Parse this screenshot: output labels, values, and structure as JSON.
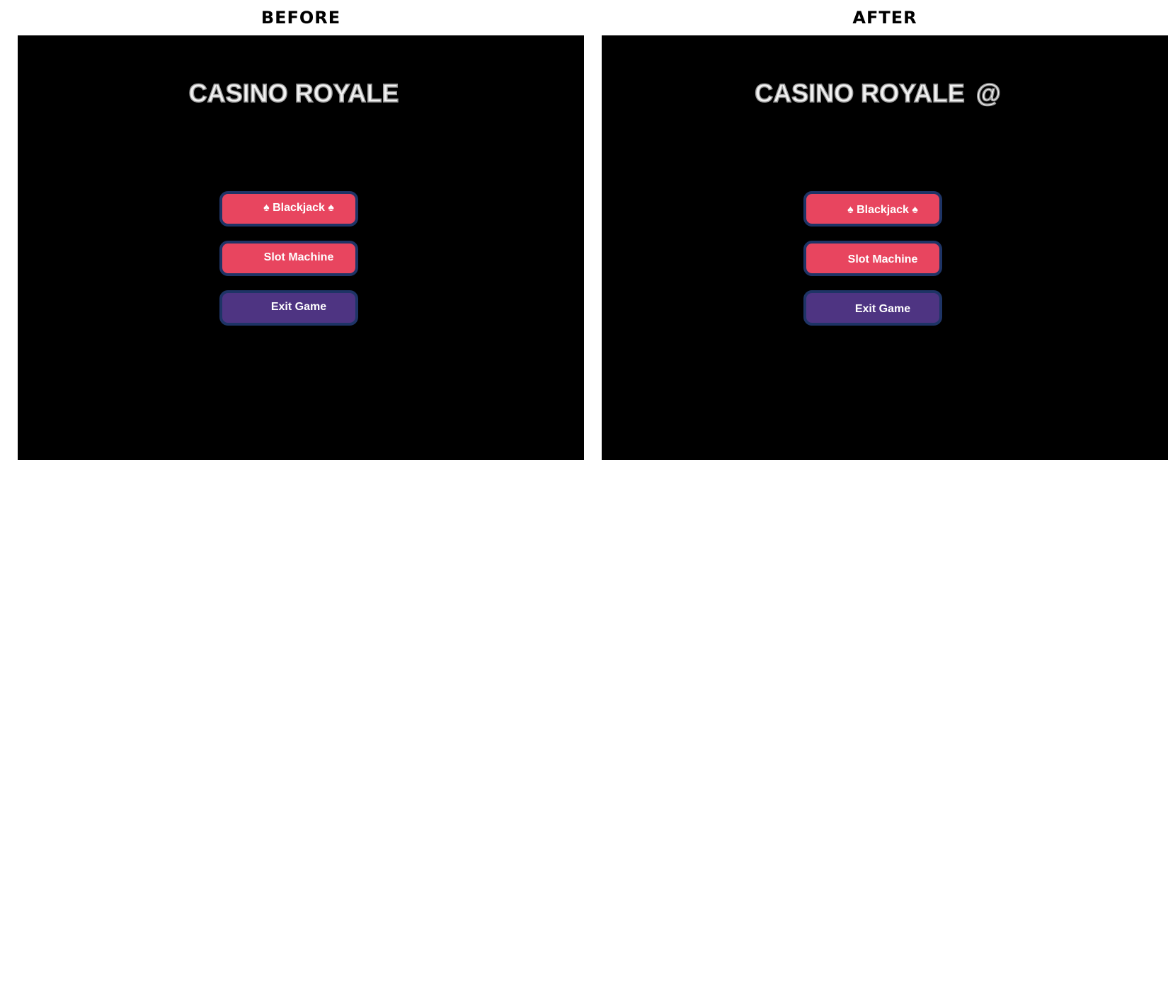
{
  "panels": {
    "before": {
      "heading": "BEFORE",
      "game": {
        "title": "CASINO ROYALE",
        "title_extra": "",
        "buttons": {
          "blackjack": "♠ Blackjack ♠",
          "slot_machine": "Slot Machine",
          "exit_game": "Exit Game"
        }
      }
    },
    "after": {
      "heading": "AFTER",
      "game": {
        "title": "CASINO ROYALE",
        "title_extra": "@",
        "buttons": {
          "blackjack": "♠ Blackjack ♠",
          "slot_machine": "Slot Machine",
          "exit_game": "Exit Game"
        }
      }
    }
  },
  "colors": {
    "screen_background": "#000000",
    "primary_button": "#e8455f",
    "exit_button": "#4e3482",
    "button_border": "#1e3466",
    "title_text": "#f2f2f2"
  }
}
